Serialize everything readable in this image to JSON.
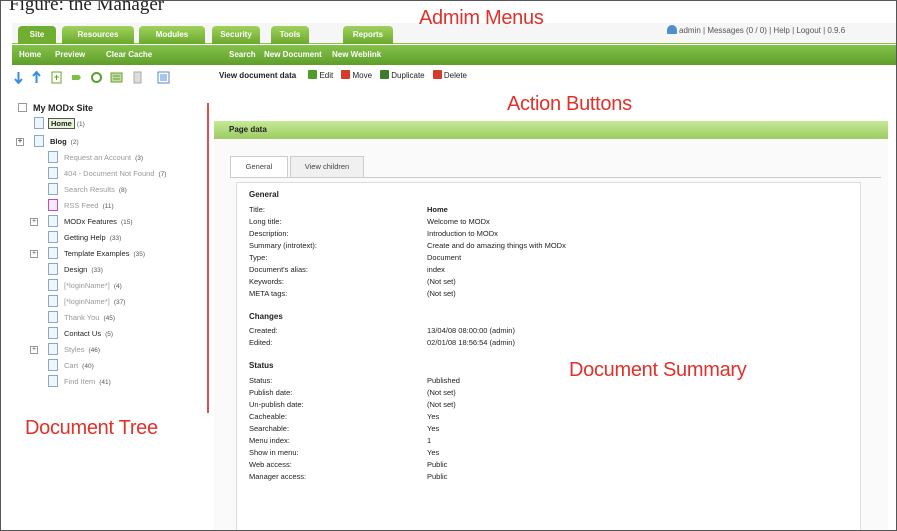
{
  "caption": "Figure: the Manager",
  "annotations": {
    "admin_menus": "Admim Menus",
    "action_buttons": "Action Buttons",
    "document_tree": "Document Tree",
    "document_summary": "Document Summary"
  },
  "topmenu": {
    "tabs": [
      "Site",
      "Resources",
      "Modules",
      "Security",
      "Tools",
      "Reports"
    ],
    "active": "Site",
    "user_area": "admin | Messages (0 / 0) | Help | Logout | 0.9.6"
  },
  "submenu": [
    "Home",
    "Preview",
    "Clear Cache",
    "Search",
    "New Document",
    "New Weblink"
  ],
  "toolbar_icons": [
    "expand-arrow-icon",
    "collapse-arrow-icon",
    "new-document-icon",
    "new-weblink-icon",
    "refresh-icon",
    "sort-icon",
    "purge-icon",
    "help-icon"
  ],
  "tree": {
    "root": "My MODx Site",
    "items": [
      {
        "label": "Home",
        "count": "(1)"
      },
      {
        "label": "Blog",
        "count": "(2)"
      },
      {
        "label": "Request an Account",
        "count": "(3)"
      },
      {
        "label": "404 - Document Not Found",
        "count": "(7)"
      },
      {
        "label": "Search Results",
        "count": "(8)"
      },
      {
        "label": "RSS Feed",
        "count": "(11)"
      },
      {
        "label": "MODx Features",
        "count": "(15)"
      },
      {
        "label": "Getting Help",
        "count": "(33)"
      },
      {
        "label": "Template Examples",
        "count": "(35)"
      },
      {
        "label": "Design",
        "count": "(33)"
      },
      {
        "label": "[*loginName*]",
        "count": "(4)"
      },
      {
        "label": "[*loginName*]",
        "count": "(37)"
      },
      {
        "label": "Thank You",
        "count": "(45)"
      },
      {
        "label": "Contact Us",
        "count": "(5)"
      },
      {
        "label": "Styles",
        "count": "(46)"
      },
      {
        "label": "Cart",
        "count": "(40)"
      },
      {
        "label": "Find Item",
        "count": "(41)"
      }
    ]
  },
  "actions": {
    "heading": "View document data",
    "buttons": [
      "Edit",
      "Move",
      "Duplicate",
      "Delete"
    ],
    "colors": [
      "#4c9d2a",
      "#d43b2a",
      "#3b7d2a",
      "#d43b2a"
    ]
  },
  "page": {
    "header": "Page data",
    "tabs": [
      "General",
      "View children"
    ]
  },
  "summary": {
    "general": {
      "title": "General",
      "rows": [
        {
          "k": "Title:",
          "v": "Home"
        },
        {
          "k": "Long title:",
          "v": "Welcome to MODx"
        },
        {
          "k": "Description:",
          "v": "Introduction to MODx"
        },
        {
          "k": "Summary (introtext):",
          "v": "Create and do amazing things with MODx"
        },
        {
          "k": "Type:",
          "v": "Document"
        },
        {
          "k": "Document's alias:",
          "v": "index"
        },
        {
          "k": "Keywords:",
          "v": "(Not set)"
        },
        {
          "k": "META tags:",
          "v": "(Not set)"
        }
      ]
    },
    "changes": {
      "title": "Changes",
      "rows": [
        {
          "k": "Created:",
          "v": "13/04/08 08:00:00 (admin)"
        },
        {
          "k": "Edited:",
          "v": "02/01/08 18:56:54 (admin)"
        }
      ]
    },
    "status": {
      "title": "Status",
      "rows": [
        {
          "k": "Status:",
          "v": "Published"
        },
        {
          "k": "Publish date:",
          "v": "(Not set)"
        },
        {
          "k": "Un-publish date:",
          "v": "(Not set)"
        },
        {
          "k": "Cacheable:",
          "v": "Yes"
        },
        {
          "k": "Searchable:",
          "v": "Yes"
        },
        {
          "k": "Menu index:",
          "v": "1"
        },
        {
          "k": "Show in menu:",
          "v": "Yes"
        },
        {
          "k": "Web access:",
          "v": "Public"
        },
        {
          "k": "Manager access:",
          "v": "Public"
        }
      ]
    }
  }
}
